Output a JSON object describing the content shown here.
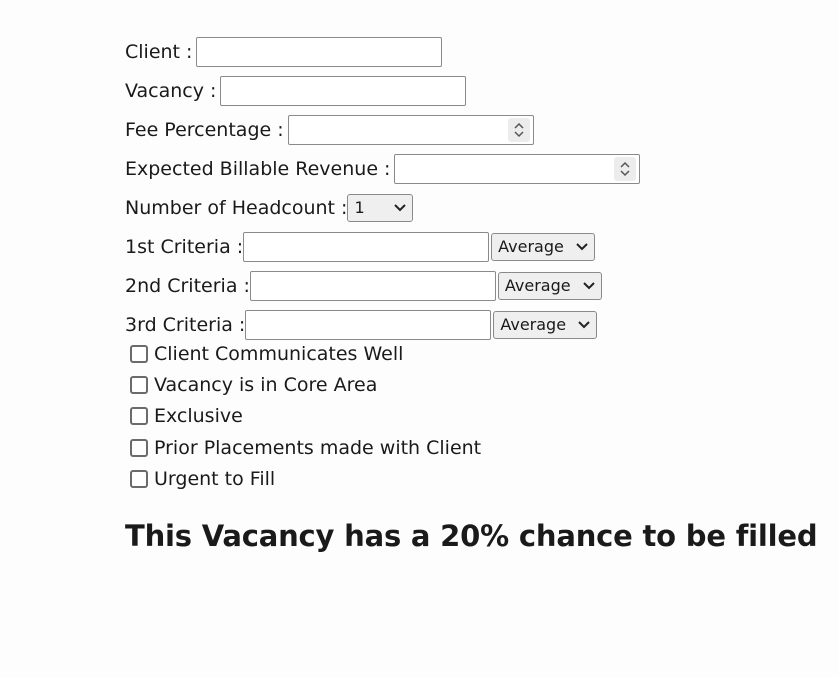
{
  "form": {
    "client_label": "Client :",
    "client_value": "",
    "vacancy_label": "Vacancy :",
    "vacancy_value": "",
    "fee_label": "Fee Percentage :",
    "fee_value": "",
    "revenue_label": "Expected Billable Revenue :",
    "revenue_value": "",
    "headcount_label": "Number of Headcount :",
    "headcount_value": "1",
    "criteria": [
      {
        "label": "1st Criteria :",
        "value": "",
        "rating": "Average"
      },
      {
        "label": "2nd Criteria :",
        "value": "",
        "rating": "Average"
      },
      {
        "label": "3rd Criteria :",
        "value": "",
        "rating": "Average"
      }
    ]
  },
  "checkboxes": [
    {
      "label": "Client Communicates Well",
      "checked": false
    },
    {
      "label": "Vacancy is in Core Area",
      "checked": false
    },
    {
      "label": "Exclusive",
      "checked": false
    },
    {
      "label": "Prior Placements made with Client",
      "checked": false
    },
    {
      "label": "Urgent to Fill",
      "checked": false
    }
  ],
  "result": {
    "text": "This Vacancy has a 20% chance to be filled"
  },
  "icons": {
    "spinner": "spinner-arrows-icon",
    "dropdown": "chevron-down-icon"
  }
}
